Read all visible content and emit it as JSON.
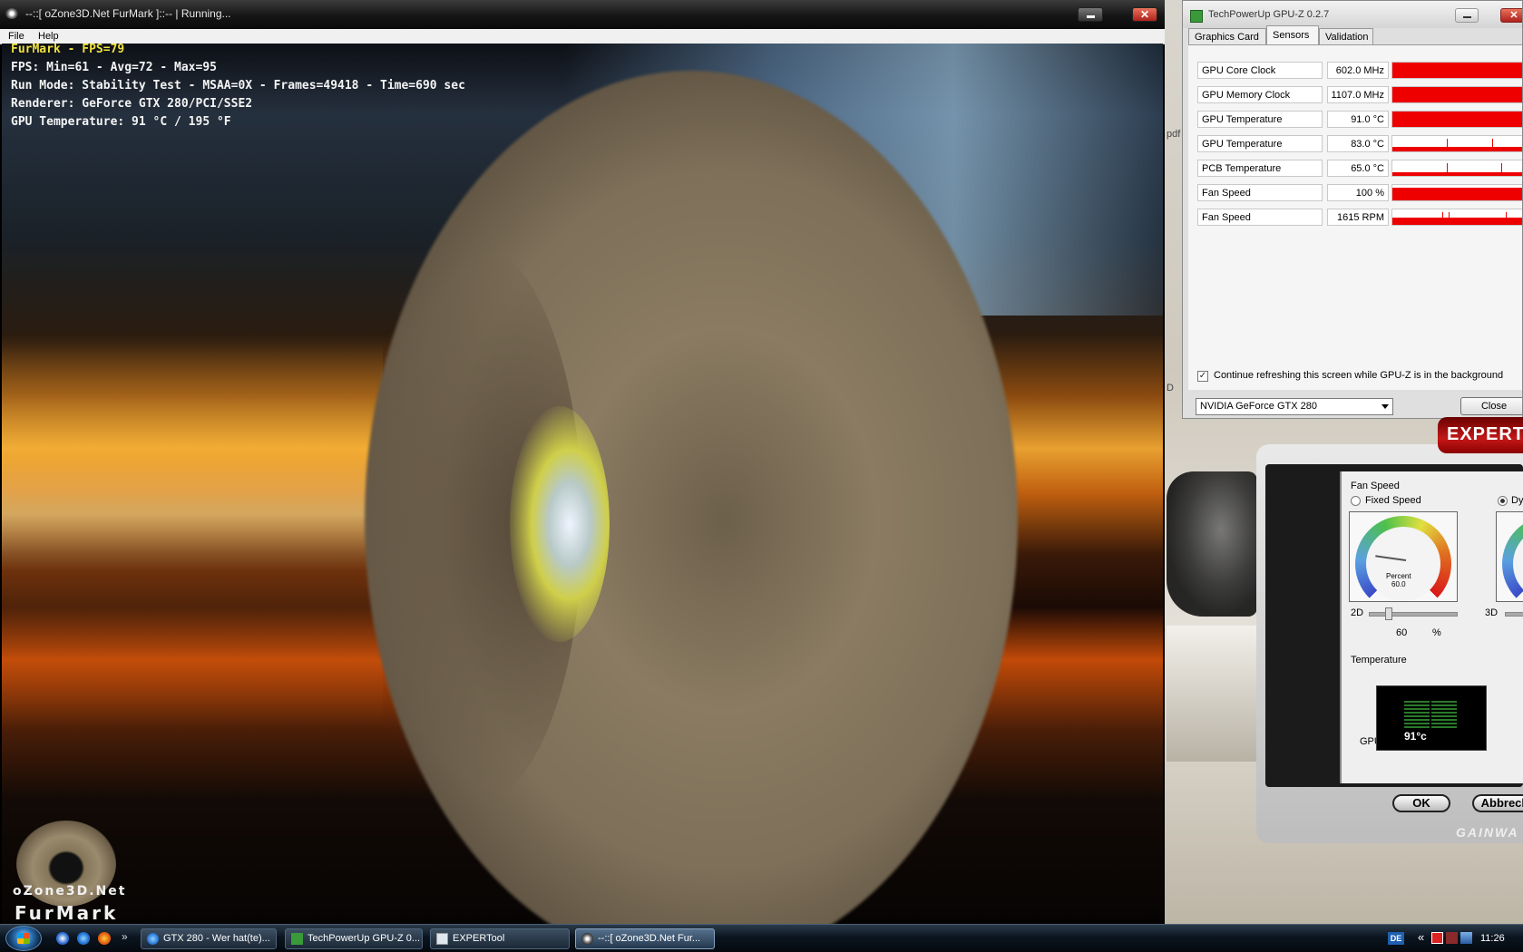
{
  "furmark": {
    "title": "--::[ oZone3D.Net FurMark ]::-- | Running...",
    "menu": [
      "File",
      "Help"
    ],
    "hud": {
      "fps": "FurMark - FPS=79",
      "fps_stats": "FPS: Min=61 - Avg=72 - Max=95",
      "run_mode": "Run Mode: Stability Test - MSAA=0X - Frames=49418 - Time=690 sec",
      "renderer": "Renderer: GeForce GTX 280/PCI/SSE2",
      "gpu_temp": "GPU Temperature: 91 °C / 195 °F"
    },
    "logo_line1": "oZone3D.Net",
    "logo_line2": "FurMark",
    "close_glyph": "✕"
  },
  "gpuz": {
    "title": "TechPowerUp GPU-Z 0.2.7",
    "close_glyph": "✕",
    "tabs": [
      "Graphics Card",
      "Sensors",
      "Validation"
    ],
    "active_tab": "Sensors",
    "sensors": [
      {
        "label": "GPU Core Clock",
        "value": "602.0 MHz",
        "level": 1.0
      },
      {
        "label": "GPU Memory Clock",
        "value": "1107.0 MHz",
        "level": 1.0
      },
      {
        "label": "GPU Temperature",
        "value": "91.0 °C",
        "level": 1.0
      },
      {
        "label": "GPU Temperature",
        "value": "83.0 °C",
        "level": 0.3
      },
      {
        "label": "PCB Temperature",
        "value": "65.0 °C",
        "level": 0.25
      },
      {
        "label": "Fan Speed",
        "value": "100 %",
        "level": 0.85
      },
      {
        "label": "Fan Speed",
        "value": "1615 RPM",
        "level": 0.45
      }
    ],
    "refresh_checkbox_label": "Continue refreshing this screen while GPU-Z is in the background",
    "refresh_checked": true,
    "card_select": "NVIDIA GeForce GTX 280",
    "close_button": "Close"
  },
  "expertool": {
    "header": "EXPERT",
    "fan_speed_group": "Fan Speed",
    "fixed_speed": "Fixed Speed",
    "dynamic_partial": "Dy",
    "gauge_title": "Percent",
    "gauge_value": "60.0",
    "label_2d": "2D",
    "label_3d": "3D",
    "slider_value": "60",
    "slider_unit": "%",
    "temperature_group": "Temperature",
    "temp_reading": "91°c",
    "gpu_label": "GPU :",
    "gpu_value": "91",
    "gpu_unit": "°C",
    "ok_button": "OK",
    "cancel_button": "Abbrech",
    "brand": "GAINWA"
  },
  "desktop": {
    "partial_text_1": "pdf",
    "partial_text_2": "D"
  },
  "taskbar": {
    "quicklaunch_chevron": "»",
    "tasks": [
      {
        "label": "GTX 280 - Wer hat(te)...",
        "active": false
      },
      {
        "label": "TechPowerUp GPU-Z 0...",
        "active": false
      },
      {
        "label": "EXPERTool",
        "active": false
      },
      {
        "label": "--::[ oZone3D.Net Fur...",
        "active": true
      }
    ],
    "language": "DE",
    "tray_arrow": "«",
    "clock": "11:26"
  },
  "colors": {
    "hud_yellow": "#f0e040",
    "sensor_bar": "#ee0000",
    "close_red": "#c42a1e"
  }
}
